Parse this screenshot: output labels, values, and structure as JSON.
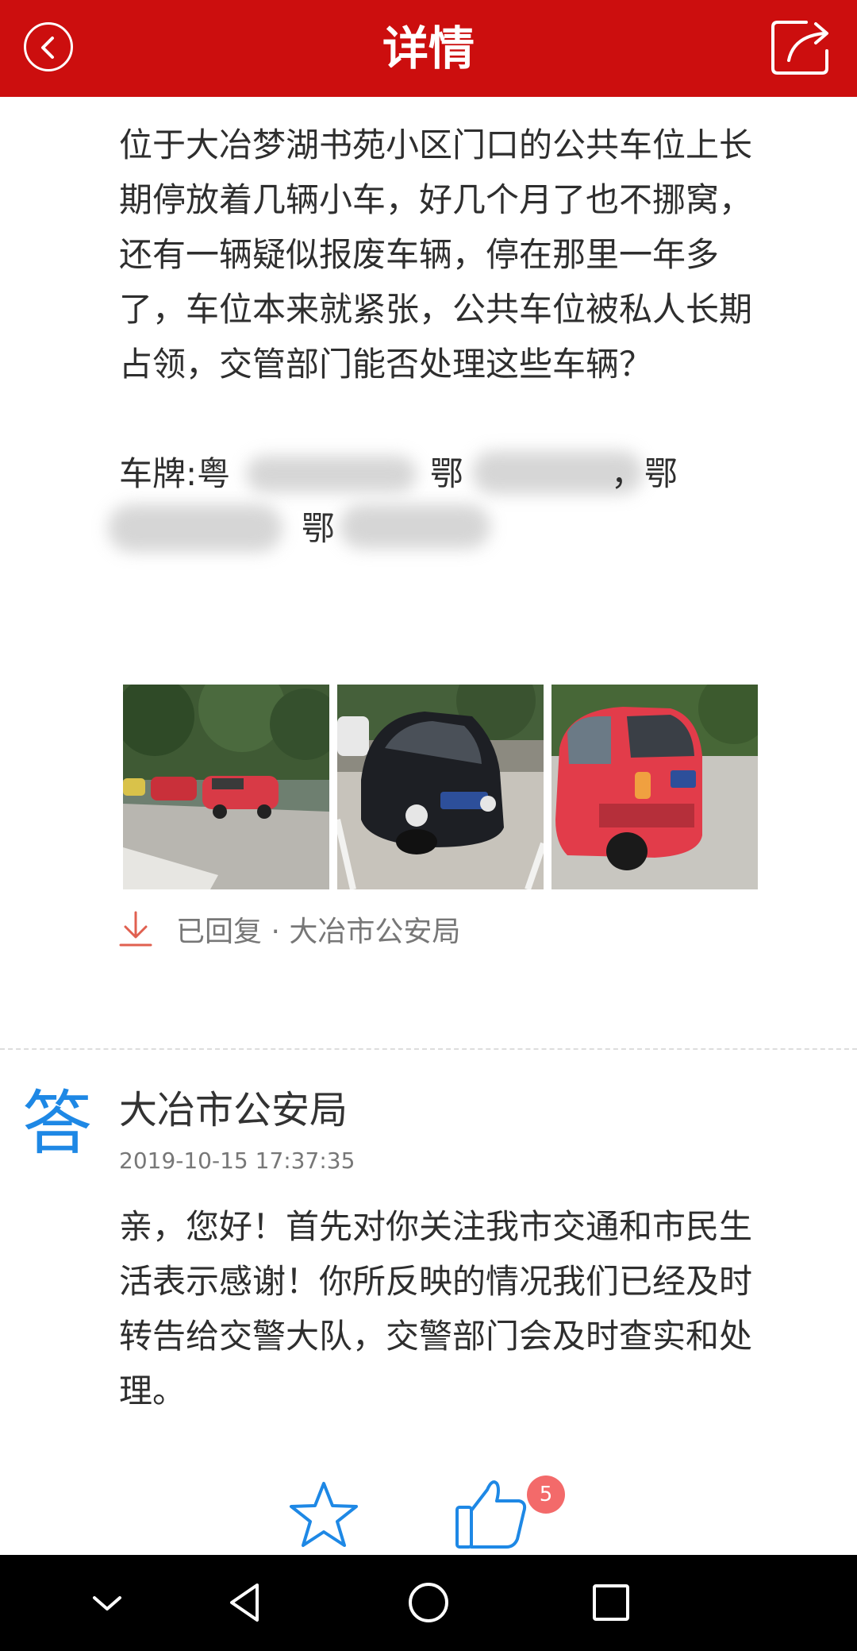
{
  "header": {
    "title": "详情",
    "back_icon": "chevron-left-icon",
    "share_icon": "share-icon",
    "bg_color": "#cc0e0e"
  },
  "question": {
    "text": "位于大冶梦湖书苑小区门口的公共车位上长期停放着几辆小车，好几个月了也不挪窝，还有一辆疑似报废车辆，停在那里一年多了，车位本来就紧张，公共车位被私人长期占领，交管部门能否处理这些车辆？",
    "plates_label": "车牌:粤",
    "plate_2_prefix": "鄂",
    "plate_3_prefix": "，鄂",
    "plate_4_prefix": "鄂"
  },
  "photos": [
    {
      "name": "photo-parked-cars-row"
    },
    {
      "name": "photo-black-sedan"
    },
    {
      "name": "photo-red-hatchback"
    }
  ],
  "reply_status": {
    "text": "已回复 · 大冶市公安局",
    "icon": "download-arrow-icon"
  },
  "answer": {
    "mark": "答",
    "author": "大冶市公安局",
    "timestamp": "2019-10-15 17:37:35",
    "text": "亲，您好！首先对你关注我市交通和市民生活表示感谢！你所反映的情况我们已经及时转告给交警大队，交警部门会及时查实和处理。"
  },
  "actions": {
    "favorite_icon": "star-icon",
    "like_icon": "thumbs-up-icon",
    "like_count": "5"
  },
  "nav": {
    "icons": [
      "chevron-down-icon",
      "back-triangle-icon",
      "home-circle-icon",
      "recents-square-icon"
    ]
  },
  "colors": {
    "accent_red": "#cc0e0e",
    "answer_blue": "#1e88e5",
    "badge_red": "#f36a6a"
  }
}
